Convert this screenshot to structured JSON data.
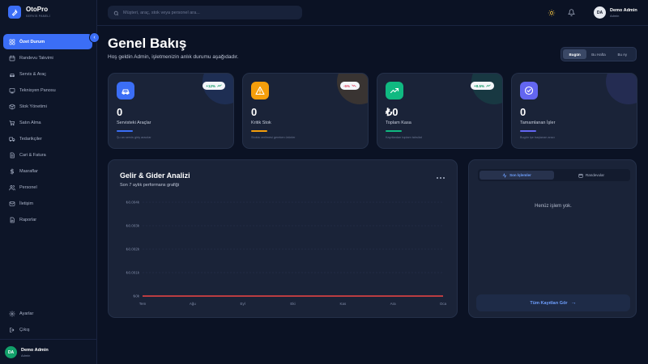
{
  "app": {
    "name": "OtoPro",
    "subtitle": "SERVİS PANELİ"
  },
  "sidebar": {
    "items": [
      {
        "label": "Özet Durum",
        "icon": "grid-icon",
        "active": true
      },
      {
        "label": "Randevu Takvimi",
        "icon": "calendar-icon"
      },
      {
        "label": "Servis & Araç",
        "icon": "car-icon"
      },
      {
        "label": "Teknisyen Panosu",
        "icon": "board-icon"
      },
      {
        "label": "Stok Yönetimi",
        "icon": "box-icon"
      },
      {
        "label": "Satın Alma",
        "icon": "cart-icon"
      },
      {
        "label": "Tedarikçiler",
        "icon": "truck-icon"
      },
      {
        "label": "Cari & Fatura",
        "icon": "invoice-icon"
      },
      {
        "label": "Masraflar",
        "icon": "dollar-icon"
      },
      {
        "label": "Personel",
        "icon": "users-icon"
      },
      {
        "label": "İletişim",
        "icon": "mail-icon"
      },
      {
        "label": "Raporlar",
        "icon": "report-icon"
      }
    ],
    "bottom": [
      {
        "label": "Ayarlar",
        "icon": "gear-icon"
      },
      {
        "label": "Çıkış",
        "icon": "logout-icon"
      }
    ],
    "user": {
      "initials": "DA",
      "name": "Demo Admin",
      "role": "Admin"
    }
  },
  "topbar": {
    "search_placeholder": "Müşteri, araç, stok veya personel ara...",
    "user": {
      "initials": "DA",
      "name": "Demo Admin",
      "role": "Admin"
    }
  },
  "main": {
    "title": "Genel Bakış",
    "subtitle": "Hoş geldin Admin, işletmenizin anlık durumu aşağıdadır.",
    "range_tabs": [
      "Bugün",
      "Bu Hafta",
      "Bu Ay"
    ],
    "range_active": "Bugün"
  },
  "stats": [
    {
      "value": "0",
      "label": "Servisteki Araçlar",
      "badge": "+12%",
      "badge_trend": "up",
      "note": "Şu an servis giriş aracılar",
      "color": "#3b6ef6",
      "icon": "car-icon"
    },
    {
      "value": "0",
      "label": "Kritik Stok",
      "badge": "-5%",
      "badge_trend": "down",
      "note": "Stokta verilmesi gereken ürünler",
      "color": "#f59e0b",
      "icon": "warning-icon"
    },
    {
      "value": "₺0",
      "label": "Toplam Kasa",
      "badge": "+8.5%",
      "badge_trend": "up",
      "note": "Kayıtlardan toplam tahsilat",
      "color": "#10b981",
      "icon": "trending-up-icon"
    },
    {
      "value": "0",
      "label": "Tamamlanan İşler",
      "note": "Bugün işe başlanan aracı",
      "color": "#6366f1",
      "icon": "check-circle-icon"
    }
  ],
  "chart_panel": {
    "title": "Gelir & Gider Analizi",
    "subtitle": "Son 7 aylık performans grafiği"
  },
  "chart_data": {
    "type": "line",
    "categories": [
      "Tem",
      "Ağu",
      "Eyl",
      "Eki",
      "Kas",
      "Ara",
      "Oca"
    ],
    "y_ticks": [
      "₺0.004k",
      "₺0.003k",
      "₺0.002k",
      "₺0.001k",
      "₺0k"
    ],
    "ylim": [
      0,
      0.004
    ],
    "grid": true,
    "series": [
      {
        "values": [
          0,
          0,
          0,
          0,
          0,
          0,
          0
        ],
        "color": "#ef4444"
      }
    ]
  },
  "activity_panel": {
    "tabs": [
      "Son İşlemler",
      "Randevular"
    ],
    "active_tab": "Son İşlemler",
    "empty_text": "Henüz işlem yok.",
    "footer_label": "Tüm Kayıtları Gör"
  }
}
